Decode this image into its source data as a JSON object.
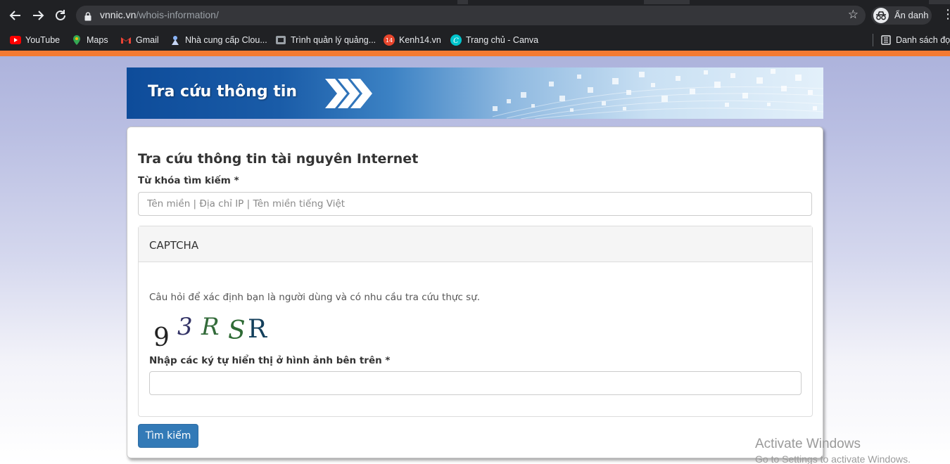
{
  "browser": {
    "url_domain": "vnnic.vn",
    "url_path": "/whois-information/",
    "incognito_label": "Ẩn danh",
    "bookmarks": [
      {
        "label": "YouTube",
        "icon": "youtube-icon",
        "color": "#ff0000"
      },
      {
        "label": "Maps",
        "icon": "maps-icon",
        "color": "#34a853"
      },
      {
        "label": "Gmail",
        "icon": "gmail-icon",
        "color": "#ea4335"
      },
      {
        "label": "Nhà cung cấp Clou...",
        "icon": "cloud-provider-icon",
        "color": "#8ab4f8"
      },
      {
        "label": "Trình quản lý quảng...",
        "icon": "ads-manager-icon",
        "color": "#9aa0a6"
      },
      {
        "label": "Kenh14.vn",
        "icon": "kenh14-icon",
        "color": "#e8452c"
      },
      {
        "label": "Trang chủ - Canva",
        "icon": "canva-icon",
        "color": "#00c4cc"
      }
    ],
    "reading_list_label": "Danh sách đọc"
  },
  "banner": {
    "title": "Tra cứu thông tin"
  },
  "form": {
    "title": "Tra cứu thông tin tài nguyên Internet",
    "keyword_label": "Từ khóa tìm kiếm *",
    "keyword_placeholder": "Tên miền | Địa chỉ IP | Tên miền tiếng Việt",
    "keyword_value": "",
    "captcha": {
      "heading": "CAPTCHA",
      "description": "Câu hỏi để xác định bạn là người dùng và có nhu cầu tra cứu thực sự.",
      "image_text": "93RSR",
      "input_label": "Nhập các ký tự hiển thị ở hình ảnh bên trên *",
      "input_value": ""
    },
    "submit_label": "Tìm kiếm"
  },
  "watermark": {
    "line1": "Activate Windows",
    "line2": "Go to Settings to activate Windows."
  },
  "colors": {
    "accent_orange": "#f47a32",
    "button_blue": "#337ab7",
    "banner_blue": "#0e4c9a"
  }
}
